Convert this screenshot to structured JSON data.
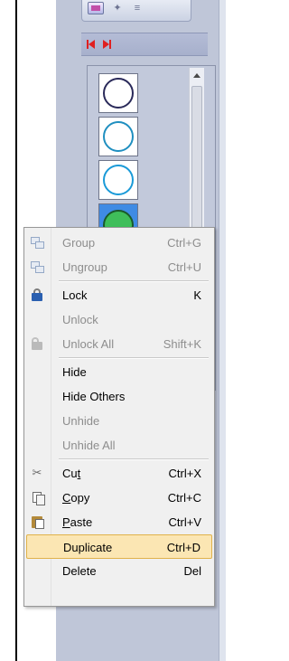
{
  "menu": {
    "items": [
      {
        "label": "Group",
        "shortcut": "Ctrl+G",
        "icon": "group-icon",
        "enabled": false
      },
      {
        "label": "Ungroup",
        "shortcut": "Ctrl+U",
        "icon": "ungroup-icon",
        "enabled": false
      },
      {
        "label": "Lock",
        "shortcut": "K",
        "icon": "lock-icon",
        "enabled": true
      },
      {
        "label": "Unlock",
        "shortcut": "",
        "icon": "",
        "enabled": false
      },
      {
        "label": "Unlock All",
        "shortcut": "Shift+K",
        "icon": "unlock-icon",
        "enabled": false
      },
      {
        "label": "Hide",
        "shortcut": "",
        "icon": "",
        "enabled": true
      },
      {
        "label": "Hide Others",
        "shortcut": "",
        "icon": "",
        "enabled": true
      },
      {
        "label": "Unhide",
        "shortcut": "",
        "icon": "",
        "enabled": false
      },
      {
        "label": "Unhide All",
        "shortcut": "",
        "icon": "",
        "enabled": false
      },
      {
        "label_pre": "Cu",
        "label_ul": "t",
        "label_post": "",
        "shortcut": "Ctrl+X",
        "icon": "scissors-icon",
        "enabled": true
      },
      {
        "label_pre": "",
        "label_ul": "C",
        "label_post": "opy",
        "shortcut": "Ctrl+C",
        "icon": "copy-icon",
        "enabled": true
      },
      {
        "label_pre": "",
        "label_ul": "P",
        "label_post": "aste",
        "shortcut": "Ctrl+V",
        "icon": "paste-icon",
        "enabled": true
      },
      {
        "label": "Duplicate",
        "shortcut": "Ctrl+D",
        "icon": "",
        "enabled": true,
        "highlighted": true
      },
      {
        "label": "Delete",
        "shortcut": "Del",
        "icon": "",
        "enabled": true
      }
    ]
  },
  "colors": {
    "highlight_bg": "#fbe6b3",
    "highlight_border": "#e0b24a",
    "disabled_text": "#8d8d8d",
    "nav_red": "#e02020"
  }
}
